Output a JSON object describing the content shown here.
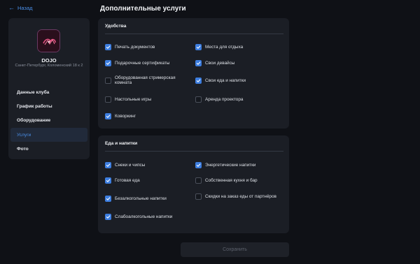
{
  "back": {
    "label": "Назад"
  },
  "page_title": "Дополнительные услуги",
  "club": {
    "name": "DOJO",
    "address": "Санкт-Петербург, Коломенский 18 к 2"
  },
  "sidebar": {
    "items": [
      {
        "label": "Данные клуба",
        "active": false
      },
      {
        "label": "График работы",
        "active": false
      },
      {
        "label": "Оборудование",
        "active": false
      },
      {
        "label": "Услуги",
        "active": true
      },
      {
        "label": "Фото",
        "active": false
      }
    ]
  },
  "amenities": {
    "title": "Удобства",
    "options": [
      {
        "label": "Печать документов",
        "checked": true
      },
      {
        "label": "Места для отдыха",
        "checked": true
      },
      {
        "label": "Подарочные сертификаты",
        "checked": true
      },
      {
        "label": "Свои девайсы",
        "checked": true
      },
      {
        "label": "Оборудованная стримерская комната",
        "checked": false
      },
      {
        "label": "Свои еда и напитки",
        "checked": true
      },
      {
        "label": "Настольные игры",
        "checked": false
      },
      {
        "label": "Аренда проектора",
        "checked": false
      },
      {
        "label": "Коворкинг",
        "checked": true
      }
    ]
  },
  "food": {
    "title": "Еда и напитки",
    "options": [
      {
        "label": "Снеки и чипсы",
        "checked": true
      },
      {
        "label": "Энергетические напитки",
        "checked": true
      },
      {
        "label": "Готовая еда",
        "checked": true
      },
      {
        "label": "Собственная кухня и бар",
        "checked": false
      },
      {
        "label": "Безалкогольные напитки",
        "checked": true
      },
      {
        "label": "Скидки на заказ еды от партнёров",
        "checked": false
      },
      {
        "label": "Слабоалкогольные напитки",
        "checked": true
      }
    ]
  },
  "save": {
    "label": "Сохранить"
  },
  "colors": {
    "accent": "#3d7ee0",
    "card": "#1b1e25",
    "background": "#0f1116"
  }
}
